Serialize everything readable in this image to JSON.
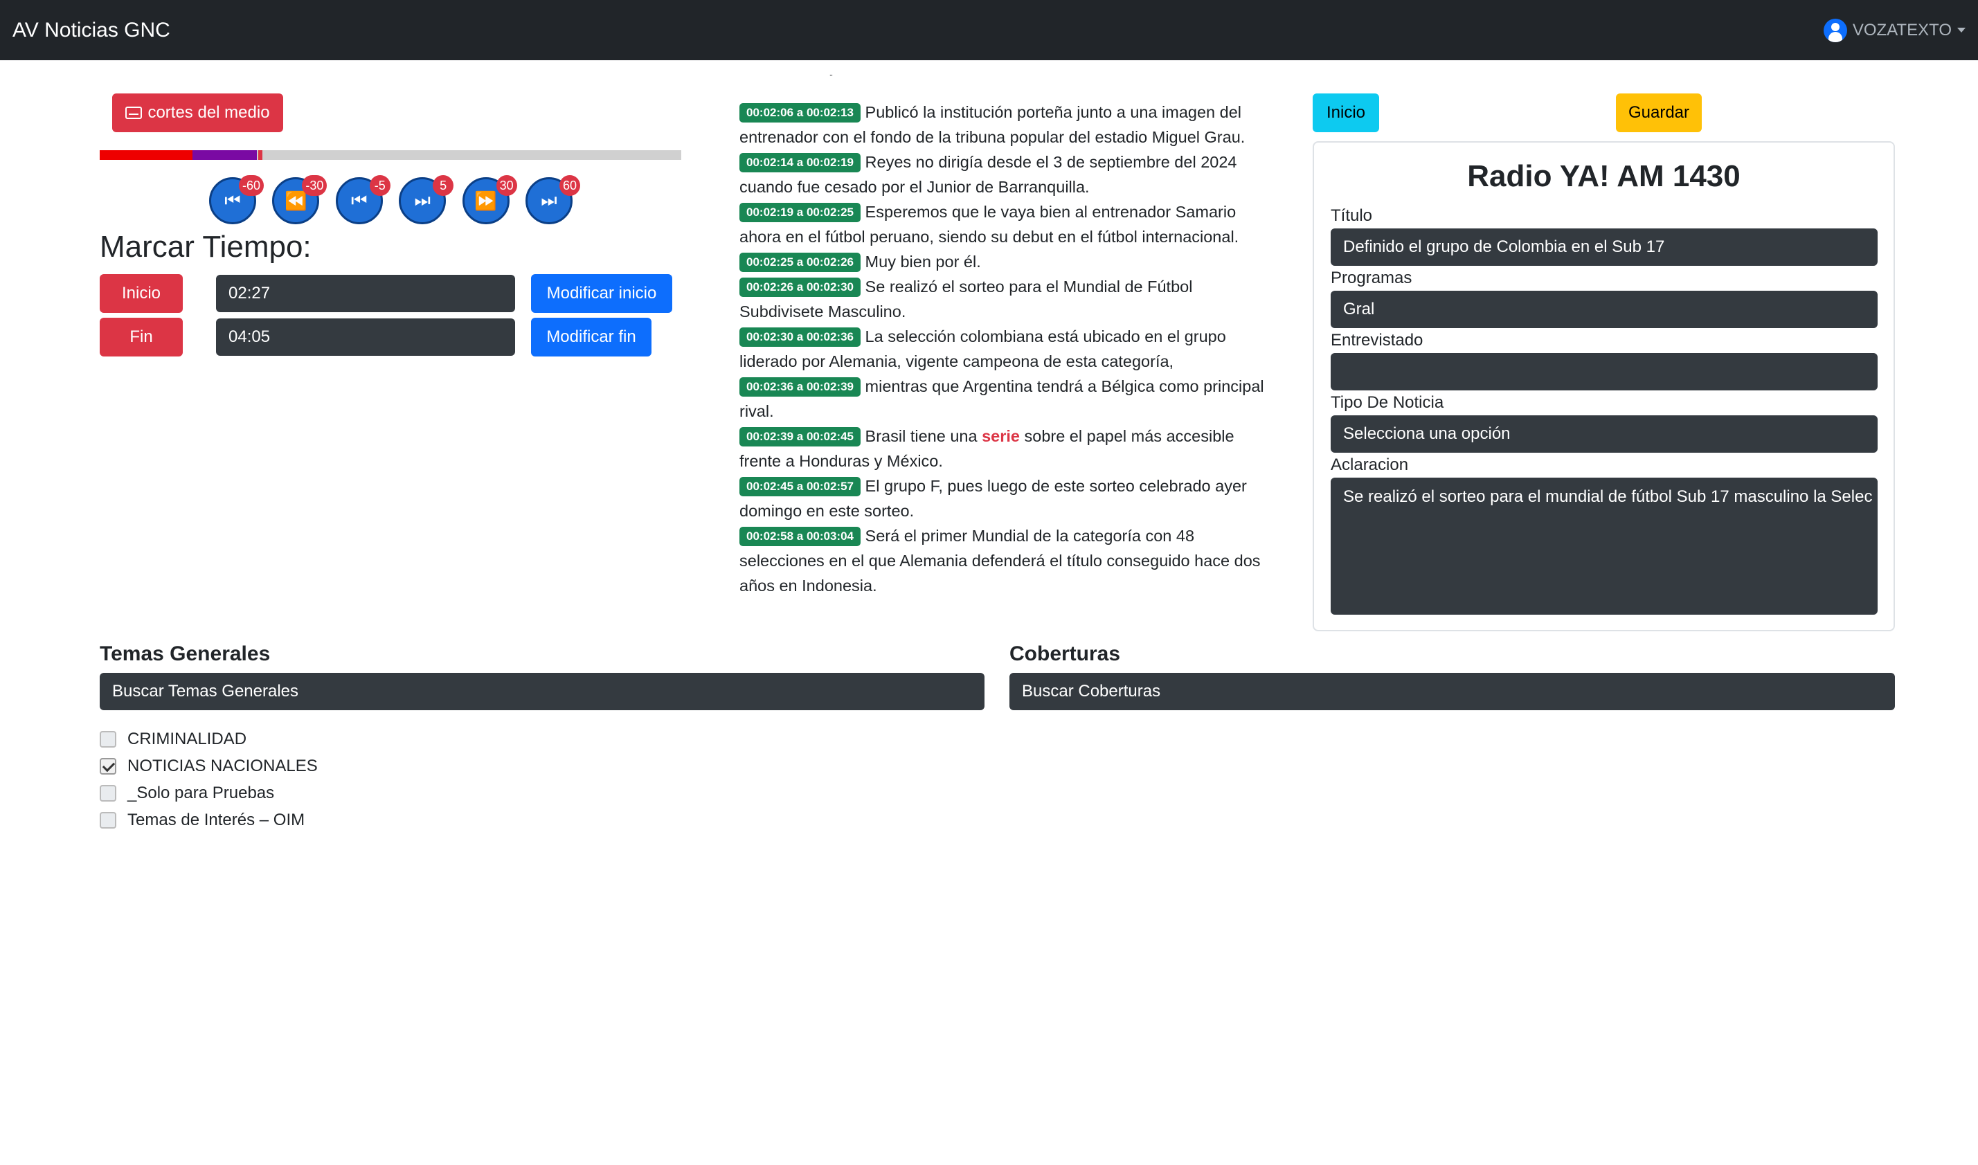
{
  "navbar": {
    "brand": "AV Noticias GNC",
    "user": "VOZATEXTO",
    "user_icon": "user-circle-icon"
  },
  "player": {
    "cortes_label": "cortes del medio",
    "cortes_icon": "captions-icon",
    "progress": {
      "played_red": 0.16,
      "played_purple": 0.27,
      "marker": 0.28
    },
    "controls": [
      {
        "name": "skip-back-60",
        "badge": "-60",
        "glyph": "⏮"
      },
      {
        "name": "skip-back-30",
        "badge": "-30",
        "glyph": "⏪"
      },
      {
        "name": "skip-back-5",
        "badge": "-5",
        "glyph": "⏮"
      },
      {
        "name": "skip-forward-5",
        "badge": "5",
        "glyph": "⏭"
      },
      {
        "name": "skip-forward-30",
        "badge": "30",
        "glyph": "⏩"
      },
      {
        "name": "skip-forward-60",
        "badge": "60",
        "glyph": "⏭"
      }
    ]
  },
  "marcar": {
    "title": "Marcar Tiempo:",
    "inicio_label": "Inicio",
    "fin_label": "Fin",
    "inicio_value": "02:27",
    "fin_value": "04:05",
    "modificar_inicio": "Modificar inicio",
    "modificar_fin": "Modificar fin"
  },
  "transcript": [
    {
      "ts": "00:02:06 a 00:02:13",
      "text": "Publicó la institución porteña junto a una imagen del entrenador con el fondo de la tribuna popular del estadio Miguel Grau."
    },
    {
      "ts": "00:02:14 a 00:02:19",
      "text": "Reyes no dirigía desde el 3 de septiembre del 2024 cuando fue cesado por el Junior de Barranquilla."
    },
    {
      "ts": "00:02:19 a 00:02:25",
      "text": "Esperemos que le vaya bien al entrenador Samario ahora en el fútbol peruano, siendo su debut en el fútbol internacional."
    },
    {
      "ts": "00:02:25 a 00:02:26",
      "text": "Muy bien por él."
    },
    {
      "ts": "00:02:26 a 00:02:30",
      "text": "Se realizó el sorteo para el Mundial de Fútbol Subdivisete Masculino."
    },
    {
      "ts": "00:02:30 a 00:02:36",
      "text": "La selección colombiana está ubicado en el grupo liderado por Alemania, vigente campeona de esta categoría,"
    },
    {
      "ts": "00:02:36 a 00:02:39",
      "text": "mientras que Argentina tendrá a Bélgica como principal rival."
    },
    {
      "ts": "00:02:39 a 00:02:45",
      "text_before": "Brasil tiene una ",
      "keyword": "serie",
      "text_after": " sobre el papel más accesible frente a Honduras y México."
    },
    {
      "ts": "00:02:45 a 00:02:57",
      "text": "El grupo F, pues luego de este sorteo celebrado ayer domingo en este sorteo."
    },
    {
      "ts": "00:02:58 a 00:03:04",
      "text": "Será el primer Mundial de la categoría con 48 selecciones en el que Alemania defenderá el título conseguido hace dos años en Indonesia."
    }
  ],
  "form": {
    "inicio_button": "Inicio",
    "guardar_button": "Guardar",
    "station": "Radio YA! AM 1430",
    "titulo_label": "Título",
    "titulo_value": "Definido el grupo de Colombia en el Sub 17",
    "programas_label": "Programas",
    "programas_value": "Gral",
    "entrevistado_label": "Entrevistado",
    "entrevistado_value": "",
    "tipo_label": "Tipo De Noticia",
    "tipo_value": "Selecciona una opción",
    "aclaracion_label": "Aclaracion",
    "aclaracion_value": "Se realizó el sorteo para el mundial de fútbol Sub 17  masculino la Selec"
  },
  "temas": {
    "title": "Temas Generales",
    "search_placeholder": "Buscar Temas Generales",
    "items": [
      {
        "label": "CRIMINALIDAD",
        "checked": false
      },
      {
        "label": "NOTICIAS NACIONALES",
        "checked": true
      },
      {
        "label": "_Solo para Pruebas",
        "checked": false
      },
      {
        "label": "Temas de Interés – OIM",
        "checked": false
      }
    ]
  },
  "coberturas": {
    "title": "Coberturas",
    "search_placeholder": "Buscar Coberturas"
  }
}
